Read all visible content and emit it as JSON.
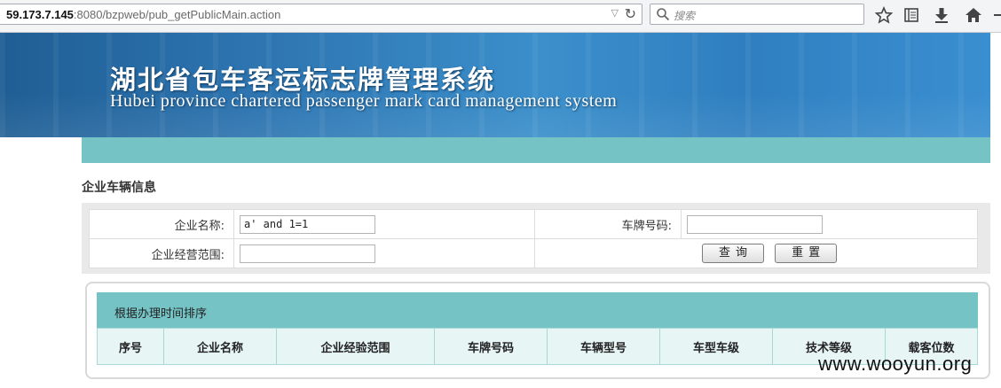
{
  "browser": {
    "url_host": "59.173.7.145",
    "url_rest": ":8080/bzpweb/pub_getPublicMain.action",
    "search_placeholder": "搜索"
  },
  "banner": {
    "title_cn": "湖北省包车客运标志牌管理系统",
    "title_en": "Hubei province chartered passenger mark card management system"
  },
  "page": {
    "section_title": "企业车辆信息"
  },
  "form": {
    "company_name_label": "企业名称:",
    "company_name_value": "a' and 1=1",
    "plate_label": "车牌号码:",
    "plate_value": "",
    "scope_label": "企业经营范围:",
    "scope_value": "",
    "query_button": "查询",
    "reset_button": "重置"
  },
  "list": {
    "header_text": "根据办理时间排序",
    "columns": [
      "序号",
      "企业名称",
      "企业经验范围",
      "车牌号码",
      "车辆型号",
      "车型车级",
      "技术等级",
      "载客位数"
    ]
  },
  "watermark": "www.wooyun.org"
}
